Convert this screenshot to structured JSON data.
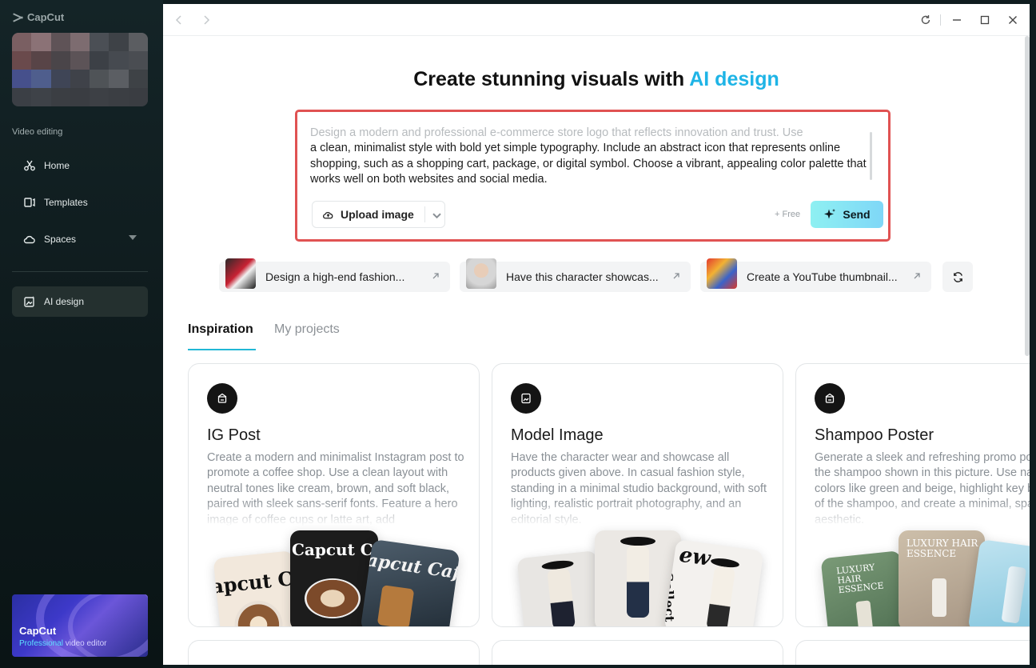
{
  "app": {
    "brand": "CapCut"
  },
  "sidebar": {
    "section_label": "Video editing",
    "items": [
      {
        "label": "Home",
        "icon": "scissors-icon"
      },
      {
        "label": "Templates",
        "icon": "templates-icon"
      },
      {
        "label": "Spaces",
        "icon": "cloud-icon"
      }
    ],
    "active_item": {
      "label": "AI design",
      "icon": "ai-design-icon"
    },
    "promo": {
      "title": "CapCut",
      "sub_highlight": "Professional",
      "sub_rest": " video editor"
    }
  },
  "hero": {
    "title_prefix": "Create stunning visuals with ",
    "title_accent": "AI design"
  },
  "prompt": {
    "line1": "Design a modern and professional e-commerce store logo that reflects innovation and trust. Use",
    "rest": "a clean, minimalist style with bold yet simple typography. Include an abstract icon that represents online shopping, such as a shopping cart, package, or digital symbol. Choose a vibrant, appealing color palette that works well on both websites and social media.",
    "upload_label": "Upload image",
    "free_label": "+ Free",
    "send_label": "Send"
  },
  "suggestions": [
    {
      "label": "Design a high-end fashion..."
    },
    {
      "label": "Have this character showcas..."
    },
    {
      "label": "Create a YouTube thumbnail..."
    }
  ],
  "tabs": [
    {
      "label": "Inspiration",
      "active": true
    },
    {
      "label": "My projects",
      "active": false
    }
  ],
  "cards": [
    {
      "title": "IG Post",
      "desc": "Create a modern and minimalist Instagram post to promote a coffee shop. Use a clean layout with neutral tones like cream, brown, and soft black, paired with sleek sans-serif fonts. Feature a hero image of coffee cups or latte art, add",
      "art_text": [
        "apcut C",
        "Capcut Caf",
        "apcut Cafe"
      ]
    },
    {
      "title": "Model Image",
      "desc": "Have the character wear and showcase all products given above. In casual fashion style, standing in a minimal studio background, with soft lighting, realistic portrait photography, and an editorial style.",
      "art_text": [
        "ew",
        "Collect"
      ]
    },
    {
      "title": "Shampoo Poster",
      "desc": "Generate a sleek and refreshing promo poster for the shampoo shown in this picture. Use natural colors like green and beige, highlight key benefits of the shampoo, and create a minimal, spa-inspired aesthetic.",
      "art_text": [
        "LUXURY HAIR ESSENCE",
        "LUXURY HAIR ESSENCE"
      ]
    }
  ],
  "colors": {
    "accent": "#1eb4e6",
    "highlight_border": "#e05252",
    "send_gradient_start": "#8ef0f2",
    "send_gradient_end": "#7fd7f7"
  }
}
